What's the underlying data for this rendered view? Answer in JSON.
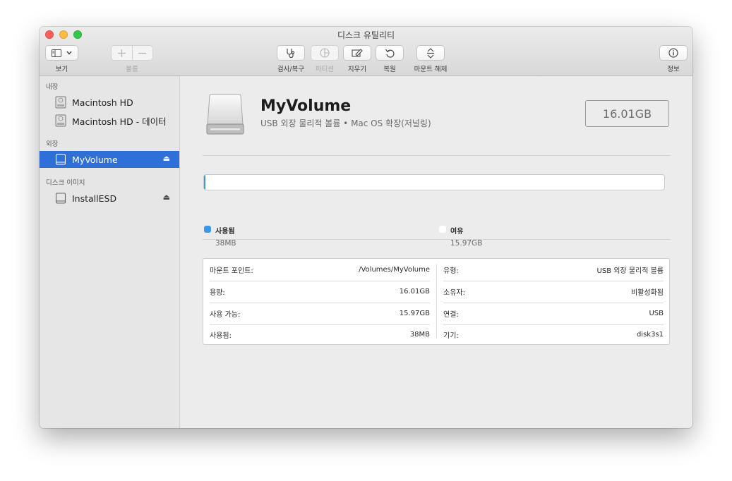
{
  "window": {
    "title": "디스크 유틸리티"
  },
  "toolbar": {
    "view_label": "보기",
    "volume_label": "볼륨",
    "firstaid_label": "검사/복구",
    "partition_label": "파티션",
    "erase_label": "지우기",
    "restore_label": "복원",
    "unmount_label": "마운트 해제",
    "info_label": "정보"
  },
  "sidebar": {
    "sections": [
      {
        "header": "내장",
        "items": [
          {
            "label": "Macintosh HD"
          },
          {
            "label": "Macintosh HD - 데이터"
          }
        ]
      },
      {
        "header": "외장",
        "items": [
          {
            "label": "MyVolume",
            "eject": "⏏",
            "selected": true
          }
        ]
      },
      {
        "header": "디스크 이미지",
        "items": [
          {
            "label": "InstallESD",
            "eject": "⏏"
          }
        ]
      }
    ]
  },
  "volume": {
    "name": "MyVolume",
    "description": "USB 외장 물리적 볼륨 • Mac OS 확장(저널링)",
    "size": "16.01GB"
  },
  "usage": {
    "used_fraction": 0.0024,
    "used_color": "#3a98e8",
    "free_color": "#ffffff",
    "used": {
      "label": "사용됨",
      "value": "38MB"
    },
    "free": {
      "label": "여유",
      "value": "15.97GB"
    }
  },
  "info": {
    "left": [
      {
        "label": "마운트 포인트:",
        "value": "/Volumes/MyVolume"
      },
      {
        "label": "용량:",
        "value": "16.01GB"
      },
      {
        "label": "사용 가능:",
        "value": "15.97GB"
      },
      {
        "label": "사용됨:",
        "value": "38MB"
      }
    ],
    "right": [
      {
        "label": "유형:",
        "value": "USB 외장 물리적 볼륨"
      },
      {
        "label": "소유자:",
        "value": "비활성화됨"
      },
      {
        "label": "연결:",
        "value": "USB"
      },
      {
        "label": "기기:",
        "value": "disk3s1"
      }
    ]
  }
}
